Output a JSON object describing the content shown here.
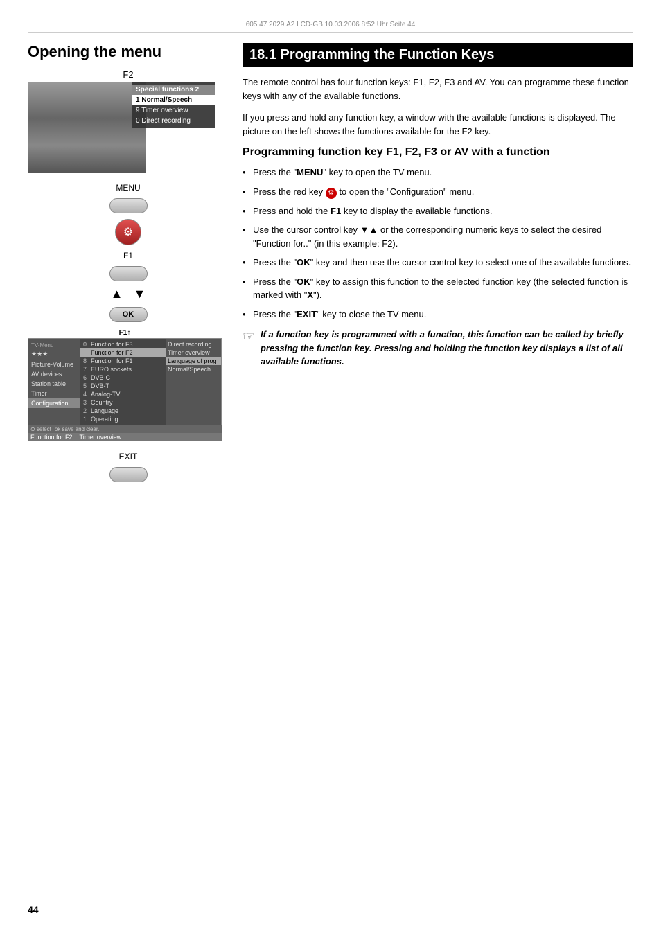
{
  "header": {
    "text": "605 47 2029.A2 LCD-GB  10.03.2006  8:52 Uhr  Seite 44"
  },
  "left_column": {
    "title": "Opening the menu",
    "f2_label": "F2",
    "menu_overlay": {
      "header": "Special functions 2",
      "items": [
        {
          "label": "Normal/Speech",
          "selected": true,
          "num": "1"
        },
        {
          "label": "",
          "num": ""
        },
        {
          "label": "",
          "num": ""
        },
        {
          "label": "Timer overview",
          "selected": false,
          "num": "9"
        },
        {
          "label": "Direct recording",
          "selected": false,
          "num": "0"
        }
      ]
    },
    "buttons": {
      "menu_label": "MENU",
      "f1_label": "F1",
      "ok_label": "OK",
      "exit_label": "EXIT"
    },
    "bottom_menu": {
      "fi_label": "F1↑",
      "sidebar_items": [
        {
          "label": "★★★",
          "active": false
        },
        {
          "label": "Picture-Volume",
          "active": false
        },
        {
          "label": "AV devices",
          "active": false
        },
        {
          "label": "Station table",
          "active": false
        },
        {
          "label": "Timer",
          "active": false
        },
        {
          "label": "Configuration",
          "active": true
        }
      ],
      "main_items": [
        {
          "num": "0",
          "label": "Function for F3",
          "selected": false
        },
        {
          "num": "",
          "label": "Function for F2",
          "selected": true
        },
        {
          "num": "8",
          "label": "Function for F1",
          "selected": false
        },
        {
          "num": "7",
          "label": "EURO sockets",
          "selected": false
        },
        {
          "num": "6",
          "label": "DVB-C",
          "selected": false
        },
        {
          "num": "5",
          "label": "DVB-T",
          "selected": false
        },
        {
          "num": "4",
          "label": "Analog-TV",
          "selected": false
        },
        {
          "num": "3",
          "label": "Country",
          "selected": false
        },
        {
          "num": "2",
          "label": "Language",
          "selected": false
        },
        {
          "num": "1",
          "label": "Operating",
          "selected": false
        }
      ],
      "right_items": [
        {
          "label": "Direct recording",
          "selected": false
        },
        {
          "label": "Timer overview",
          "selected": false
        },
        {
          "label": "Language of prog",
          "selected": true
        },
        {
          "label": "Normal/Speech",
          "selected": false
        }
      ],
      "bottom_labels": [
        "select",
        "ok save and clear."
      ],
      "function_labels": [
        "Function for F2",
        "Timer overview"
      ]
    }
  },
  "right_column": {
    "title": "18.1 Programming the Function Keys",
    "intro": "The remote control has four function keys: F1, F2, F3 and AV. You can programme these function keys with any of the available functions.",
    "intro2": "If you press and hold any function key, a window with the available functions is displayed. The picture on the left shows the functions available for the F2 key.",
    "sub_heading": "Programming function key F1, F2, F3 or AV with a function",
    "bullets": [
      "Press the \"MENU\" key to open the TV menu.",
      "Press the red key Ⓢ to open the \"Configuration\" menu.",
      "Press and hold the F1 key to display the available functions.",
      "Use the cursor control key ▼▲ or the corresponding numeric keys to select the desired \"Function for..\" (in this example: F2).",
      "Press the \"OK\" key and then use the cursor control key to select one of the available functions.",
      "Press the \"OK\" key to assign this function to the selected function key (the selected function is marked with \"X\").",
      "Press the \"EXIT\" key to close the TV menu."
    ],
    "note": {
      "icon": "☞",
      "text": "If a function key is programmed with a function, this function can be called by briefly pressing the function key. Pressing and holding the function key displays a list of all available functions."
    }
  },
  "page_number": "44"
}
